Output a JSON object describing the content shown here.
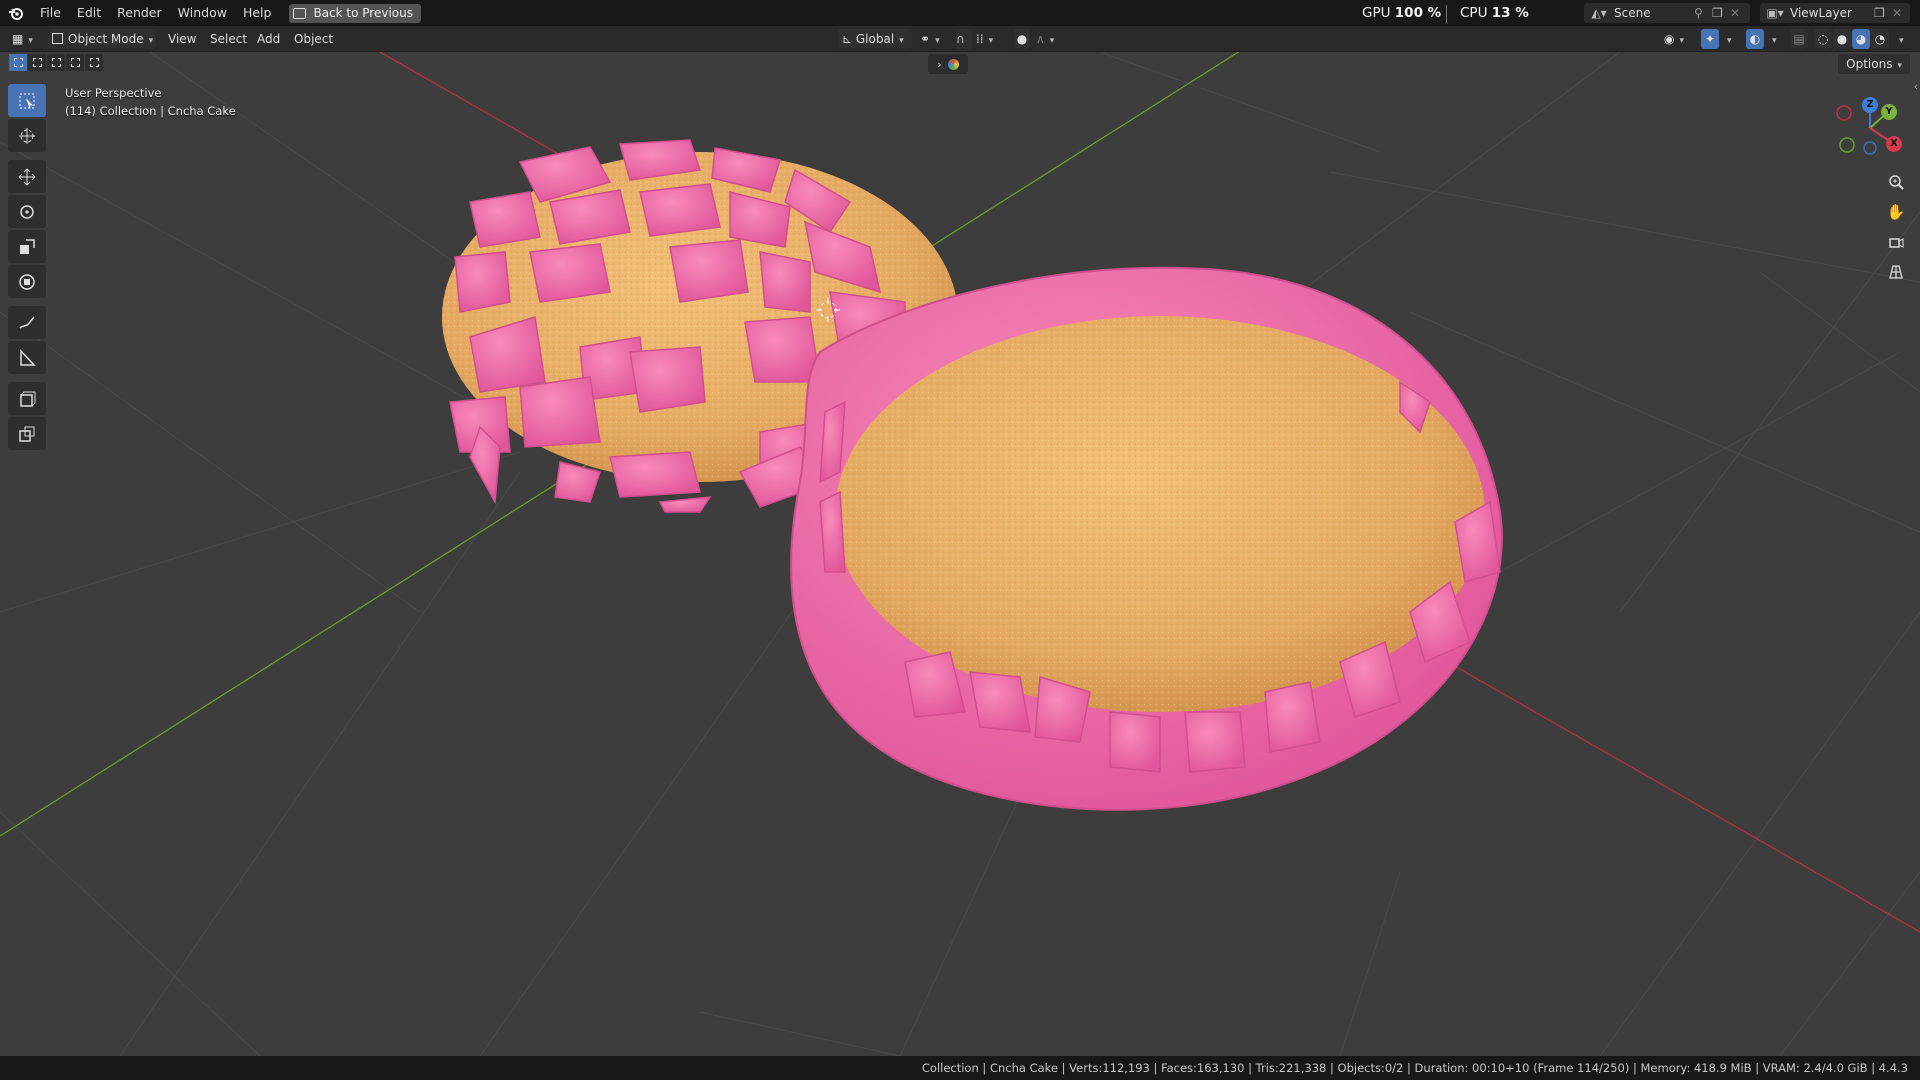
{
  "topbar": {
    "menus": [
      "File",
      "Edit",
      "Render",
      "Window",
      "Help"
    ],
    "back_label": "Back to Previous",
    "gpu_label": "GPU",
    "gpu_value": "100 %",
    "cpu_label": "CPU",
    "cpu_value": "13 %",
    "scene": "Scene",
    "view_layer": "ViewLayer"
  },
  "header": {
    "mode": "Object Mode",
    "menus": [
      "View",
      "Select",
      "Add",
      "Object"
    ],
    "orientation": "Global",
    "options": "Options"
  },
  "viewport": {
    "perspective": "User Perspective",
    "collection_info": "(114) Collection | Cncha Cake",
    "gizmo": {
      "x": "X",
      "y": "Y",
      "z": "Z"
    }
  },
  "status": {
    "text": "Collection | Cncha Cake | Verts:112,193 | Faces:163,130 | Tris:221,338 | Objects:0/2 | Duration: 00:10+10 (Frame 114/250) | Memory: 418.9 MiB | VRAM: 2.4/4.0 GiB | 4.4.3"
  },
  "colors": {
    "accent": "#4772b3",
    "viewport_bg": "#3d3d3d",
    "icing": "#f06aa6",
    "bread": "#e8b26a",
    "x_axis": "#c0303f",
    "y_axis": "#6c9e2c"
  }
}
